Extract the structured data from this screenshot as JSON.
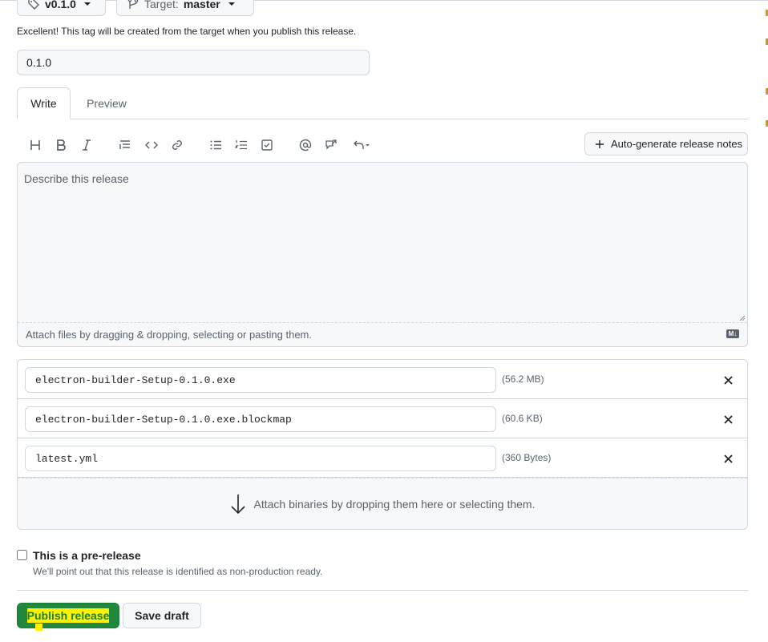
{
  "tag": {
    "value": "v0.1.0"
  },
  "target": {
    "label": "Target:",
    "value": "master"
  },
  "tag_hint": "Excellent! This tag will be created from the target when you publish this release.",
  "title_input": {
    "value": "0.1.0"
  },
  "tabs": [
    {
      "label": "Write"
    },
    {
      "label": "Preview"
    }
  ],
  "toolbar": {
    "icons": [
      "heading-icon",
      "bold-icon",
      "italic-icon",
      "quote-icon",
      "code-icon",
      "link-icon",
      "bulleted-list-icon",
      "numbered-list-icon",
      "task-list-icon",
      "mention-icon",
      "reference-icon",
      "undo-icon"
    ],
    "auto_generate_label": "Auto-generate release notes"
  },
  "editor": {
    "placeholder": "Describe this release",
    "attach_hint": "Attach files by dragging & dropping, selecting or pasting them."
  },
  "assets": [
    {
      "name": "electron-builder-Setup-0.1.0.exe",
      "size": "(56.2 MB)"
    },
    {
      "name": "electron-builder-Setup-0.1.0.exe.blockmap",
      "size": "(60.6 KB)"
    },
    {
      "name": "latest.yml",
      "size": "(360 Bytes)"
    }
  ],
  "drop_zone": "Attach binaries by dropping them here or selecting them.",
  "prerelease": {
    "label": "This is a pre-release",
    "description": "We'll point out that this release is identified as non-production ready."
  },
  "actions": {
    "publish": "Publish release",
    "save_draft": "Save draft"
  },
  "colors": {
    "primary": "#1f883d",
    "border": "#d0d7de",
    "muted": "#59636e",
    "highlight": "#fff200"
  }
}
